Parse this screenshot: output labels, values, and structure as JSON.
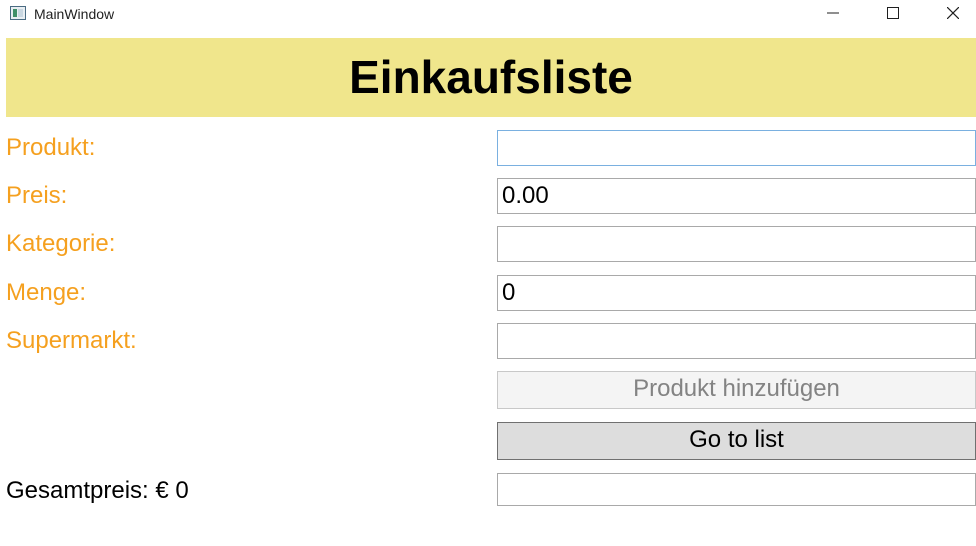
{
  "window": {
    "title": "MainWindow",
    "icons": [
      "app-icon",
      "minimize-icon",
      "maximize-icon",
      "close-icon"
    ]
  },
  "header": {
    "title": "Einkaufsliste",
    "background": "#f0e68c"
  },
  "form": {
    "label_color": "#f5a01f",
    "fields": {
      "produkt": {
        "label": "Produkt:",
        "value": ""
      },
      "preis": {
        "label": "Preis:",
        "value": "0.00"
      },
      "kategorie": {
        "label": "Kategorie:",
        "value": ""
      },
      "menge": {
        "label": "Menge:",
        "value": "0"
      },
      "supermarkt": {
        "label": "Supermarkt:",
        "value": ""
      }
    },
    "add_button": {
      "label": "Produkt hinzufügen",
      "enabled": false
    },
    "list_button": {
      "label": "Go to list"
    }
  },
  "footer": {
    "total_label": "Gesamtpreis: € 0",
    "extra_field_value": ""
  }
}
